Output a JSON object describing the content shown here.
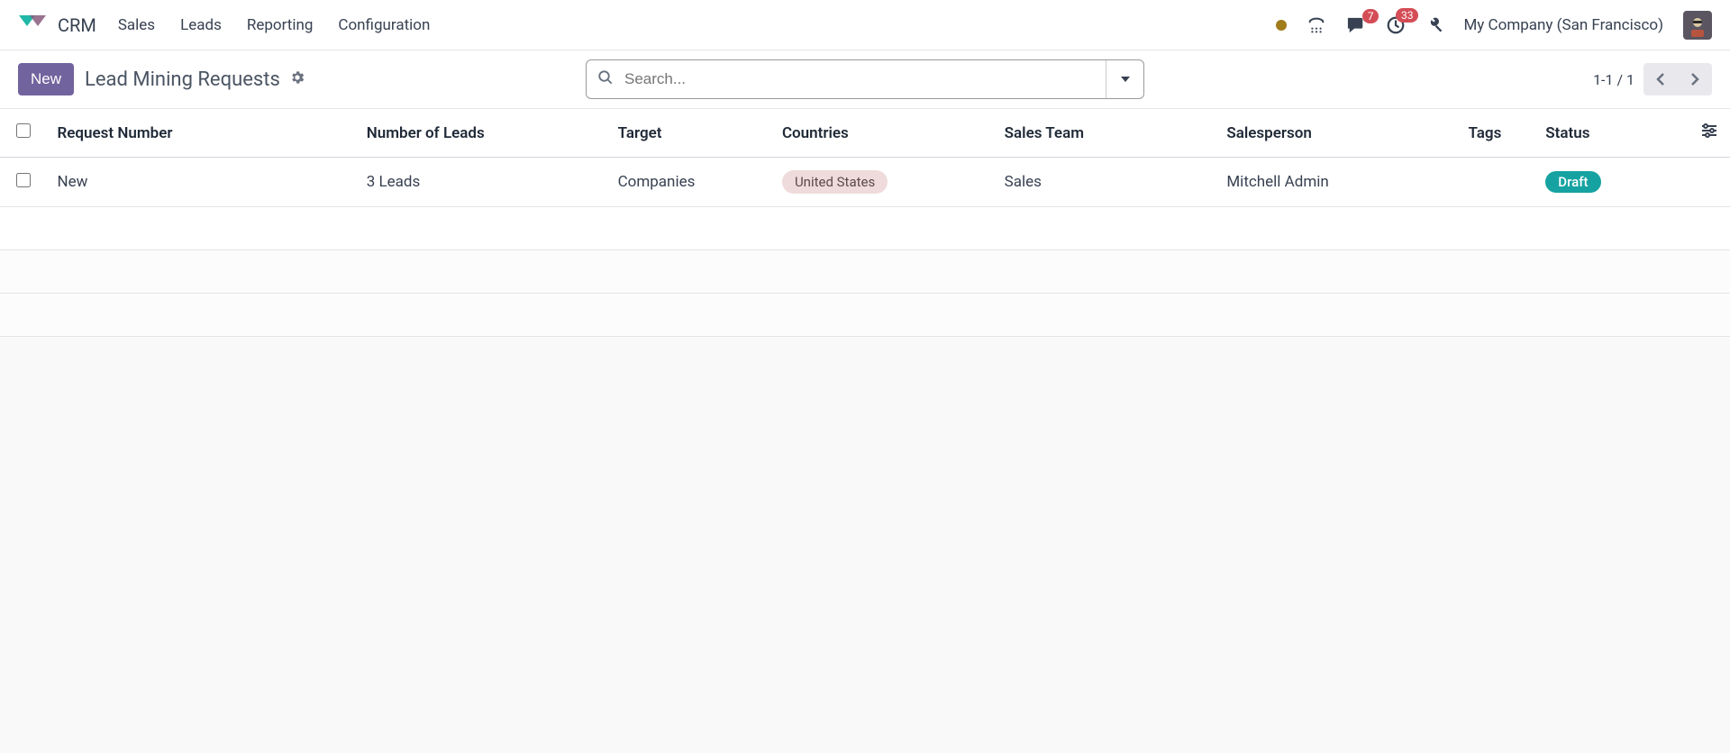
{
  "app": {
    "name": "CRM"
  },
  "nav": {
    "items": [
      "Sales",
      "Leads",
      "Reporting",
      "Configuration"
    ]
  },
  "header_right": {
    "messages_badge": "7",
    "activities_badge": "33",
    "company": "My Company (San Francisco)"
  },
  "control": {
    "new_label": "New",
    "title": "Lead Mining Requests",
    "search_placeholder": "Search..."
  },
  "pager": {
    "text": "1-1 / 1"
  },
  "table": {
    "headers": {
      "request_number": "Request Number",
      "number_of_leads": "Number of Leads",
      "target": "Target",
      "countries": "Countries",
      "sales_team": "Sales Team",
      "salesperson": "Salesperson",
      "tags": "Tags",
      "status": "Status"
    },
    "rows": [
      {
        "request_number": "New",
        "number_of_leads": "3 Leads",
        "target": "Companies",
        "countries": "United States",
        "sales_team": "Sales",
        "salesperson": "Mitchell Admin",
        "tags": "",
        "status": "Draft"
      }
    ]
  }
}
